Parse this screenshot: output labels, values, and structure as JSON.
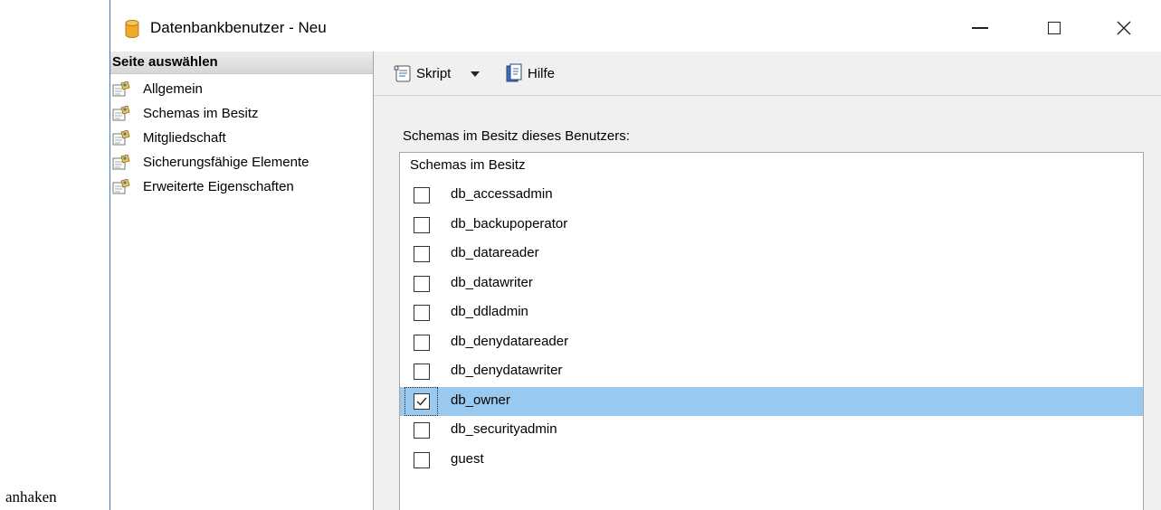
{
  "outside_label": "anhaken",
  "window": {
    "title": "Datenbankbenutzer - Neu",
    "accent_color": "#2b7fd6"
  },
  "icons": {
    "window": "database-icon",
    "nav": "page-icon",
    "script": "script-icon",
    "help": "help-icon"
  },
  "sidebar": {
    "header": "Seite auswählen",
    "items": [
      {
        "label": "Allgemein"
      },
      {
        "label": "Schemas im Besitz"
      },
      {
        "label": "Mitgliedschaft"
      },
      {
        "label": "Sicherungsfähige Elemente"
      },
      {
        "label": "Erweiterte Eigenschaften"
      }
    ]
  },
  "toolbar": {
    "script_label": "Skript",
    "help_label": "Hilfe"
  },
  "main": {
    "section_caption": "Schemas im Besitz dieses Benutzers:",
    "list_header": "Schemas im Besitz",
    "selection_color": "#99c9ef",
    "schemas": [
      {
        "name": "db_accessadmin",
        "checked": false
      },
      {
        "name": "db_backupoperator",
        "checked": false
      },
      {
        "name": "db_datareader",
        "checked": false
      },
      {
        "name": "db_datawriter",
        "checked": false
      },
      {
        "name": "db_ddladmin",
        "checked": false
      },
      {
        "name": "db_denydatareader",
        "checked": false
      },
      {
        "name": "db_denydatawriter",
        "checked": false
      },
      {
        "name": "db_owner",
        "checked": true,
        "selected": true
      },
      {
        "name": "db_securityadmin",
        "checked": false
      },
      {
        "name": "guest",
        "checked": false
      }
    ]
  }
}
